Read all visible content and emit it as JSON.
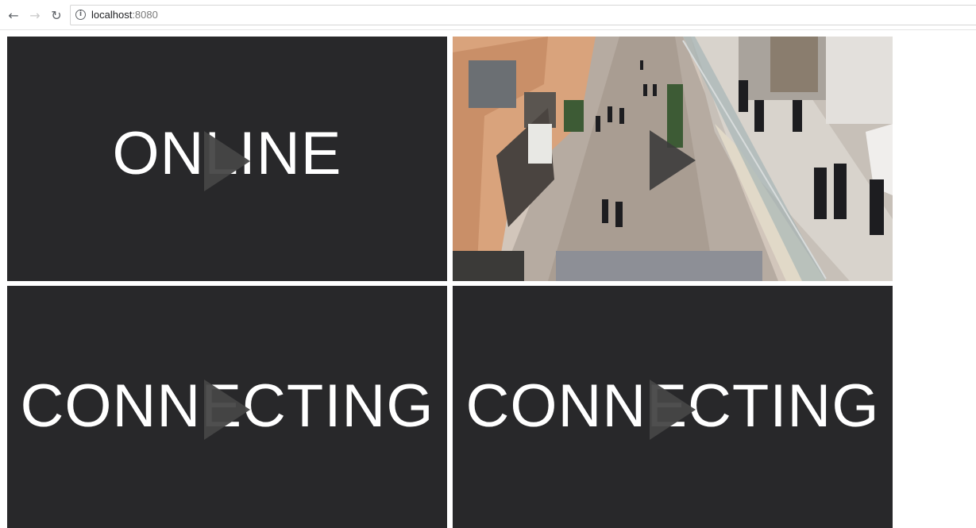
{
  "browser": {
    "back_icon": "arrow-left",
    "forward_icon": "arrow-right",
    "reload_icon": "reload",
    "info_icon": "info-circle",
    "url_host": "localhost",
    "url_port": ":8080"
  },
  "streams": [
    {
      "status": "ONLINE",
      "play_icon": "play-triangle"
    },
    {
      "status": "",
      "play_icon": "play-triangle",
      "content": "video feed of shopping mall walkway"
    },
    {
      "status": "CONNECTING",
      "play_icon": "play-triangle"
    },
    {
      "status": "CONNECTING",
      "play_icon": "play-triangle"
    }
  ],
  "colors": {
    "tile_background": "#28282a",
    "status_text": "#ffffff",
    "play_icon": "#464646"
  }
}
